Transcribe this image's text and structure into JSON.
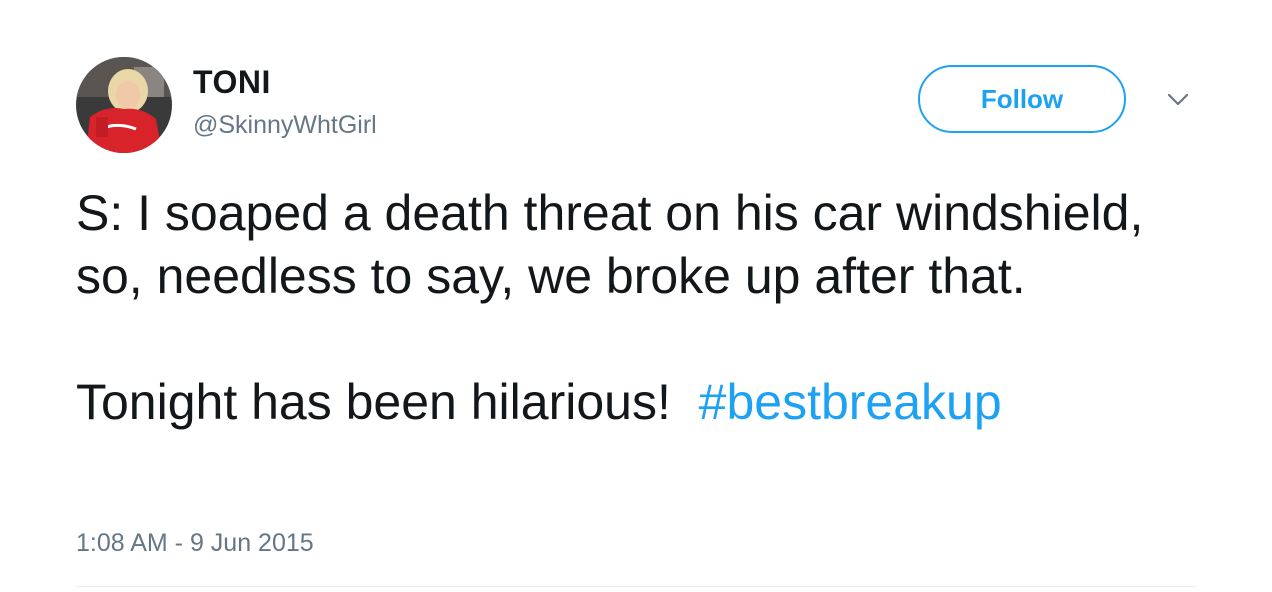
{
  "user": {
    "display_name": "TONI",
    "handle": "@SkinnyWhtGirl"
  },
  "actions": {
    "follow_label": "Follow",
    "more_icon": "chevron-down-icon"
  },
  "tweet": {
    "paragraph1": "S: I soaped a death threat on his car windshield, so, needless to say, we broke up after that.",
    "paragraph2_text": "Tonight has been hilarious!",
    "hashtag": "#bestbreakup",
    "timestamp": "1:08 AM - 9 Jun 2015"
  },
  "colors": {
    "accent": "#1da1f2",
    "text": "#14171a",
    "secondary_text": "#657786",
    "divider": "#e6ecf0"
  }
}
